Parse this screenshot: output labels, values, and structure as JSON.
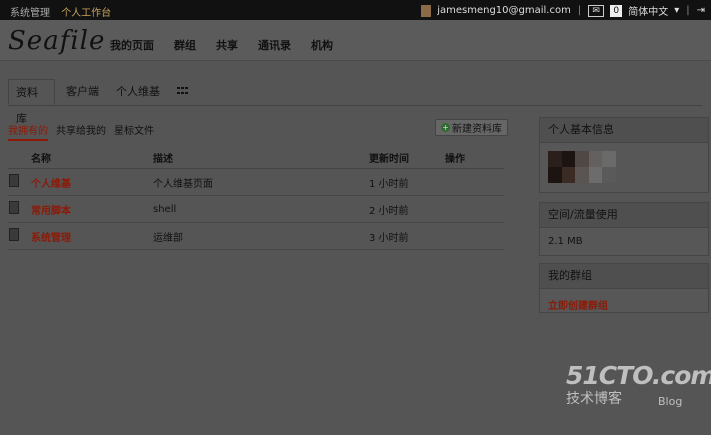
{
  "topbar": {
    "links": [
      "系统管理",
      "个人工作台"
    ],
    "user": "jamesmeng10@gmail.com",
    "unread": "0",
    "language": "简体中文"
  },
  "header": {
    "logo": "Seafile",
    "nav": [
      "我的页面",
      "群组",
      "共享",
      "通讯录",
      "机构"
    ]
  },
  "tabs": [
    "资料库",
    "客户端",
    "个人维基"
  ],
  "subtabs": [
    "我拥有的",
    "共享给我的",
    "星标文件"
  ],
  "new_library_label": "新建资料库",
  "table": {
    "headers": [
      "名称",
      "描述",
      "更新时间",
      "操作"
    ],
    "rows": [
      {
        "name": "个人维基",
        "desc": "个人维基页面",
        "time": "1 小时前"
      },
      {
        "name": "常用脚本",
        "desc": "shell",
        "time": "2 小时前"
      },
      {
        "name": "系统管理",
        "desc": "运维部",
        "time": "3 小时前"
      }
    ]
  },
  "sidebar": {
    "profile_title": "个人基本信息",
    "usage_title": "空间/流量使用",
    "usage_value": "2.1 MB",
    "groups_title": "我的群组",
    "create_group": "立即创建群组"
  },
  "watermark": {
    "line1": "51CTO.com",
    "line2": "技术博客",
    "line3": "Blog"
  }
}
